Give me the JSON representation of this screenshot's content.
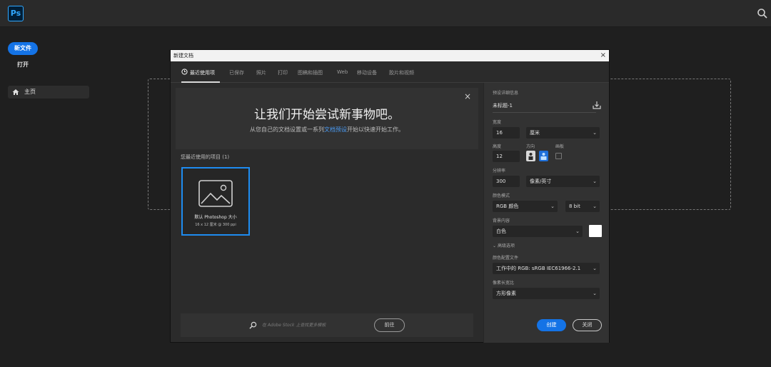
{
  "app": {
    "logo_text": "Ps"
  },
  "left_panel": {
    "new_file_label": "新文件",
    "open_label": "打开",
    "home_label": "主页"
  },
  "dialog": {
    "title": "新建文档",
    "close_glyph": "×",
    "tabs": [
      {
        "label": "最近使用项",
        "active": true
      },
      {
        "label": "已保存",
        "active": false
      },
      {
        "label": "照片",
        "active": false
      },
      {
        "label": "打印",
        "active": false
      },
      {
        "label": "图稿和插图",
        "active": false
      },
      {
        "label": "Web",
        "active": false
      },
      {
        "label": "移动设备",
        "active": false
      },
      {
        "label": "胶片和视频",
        "active": false
      }
    ],
    "banner": {
      "title": "让我们开始尝试新事物吧。",
      "subtitle_before": "从您自己的文档设置或一系列",
      "subtitle_link": "文档预设",
      "subtitle_after": "开始以快速开始工作。"
    },
    "recent": {
      "label": "您最近使用的项目 (1)",
      "preset_name": "默认 Photoshop 大小",
      "preset_size": "16 x 12 厘米 @ 300 ppi"
    },
    "stock": {
      "placeholder": "在 Adobe Stock 上查找更多模板",
      "go_label": "前往"
    },
    "details": {
      "section_label": "预设详细信息",
      "doc_name": "未标题-1",
      "width_label": "宽度",
      "width_value": "16",
      "width_unit": "厘米",
      "height_label": "高度",
      "height_value": "12",
      "orientation_label": "方向",
      "artboard_label": "画板",
      "resolution_label": "分辨率",
      "resolution_value": "300",
      "resolution_unit": "像素/英寸",
      "color_mode_label": "颜色模式",
      "color_mode_value": "RGB 颜色",
      "bit_depth_value": "8 bit",
      "background_label": "背景内容",
      "background_value": "白色",
      "background_color": "#ffffff",
      "advanced_label": "高级选项",
      "color_profile_label": "颜色配置文件",
      "color_profile_value": "工作中的 RGB: sRGB IEC61966-2.1",
      "pixel_aspect_label": "像素长宽比",
      "pixel_aspect_value": "方形像素",
      "create_label": "创建",
      "close_label": "关闭"
    }
  },
  "colors": {
    "accent": "#1473e6",
    "link": "#4b9cf5"
  }
}
